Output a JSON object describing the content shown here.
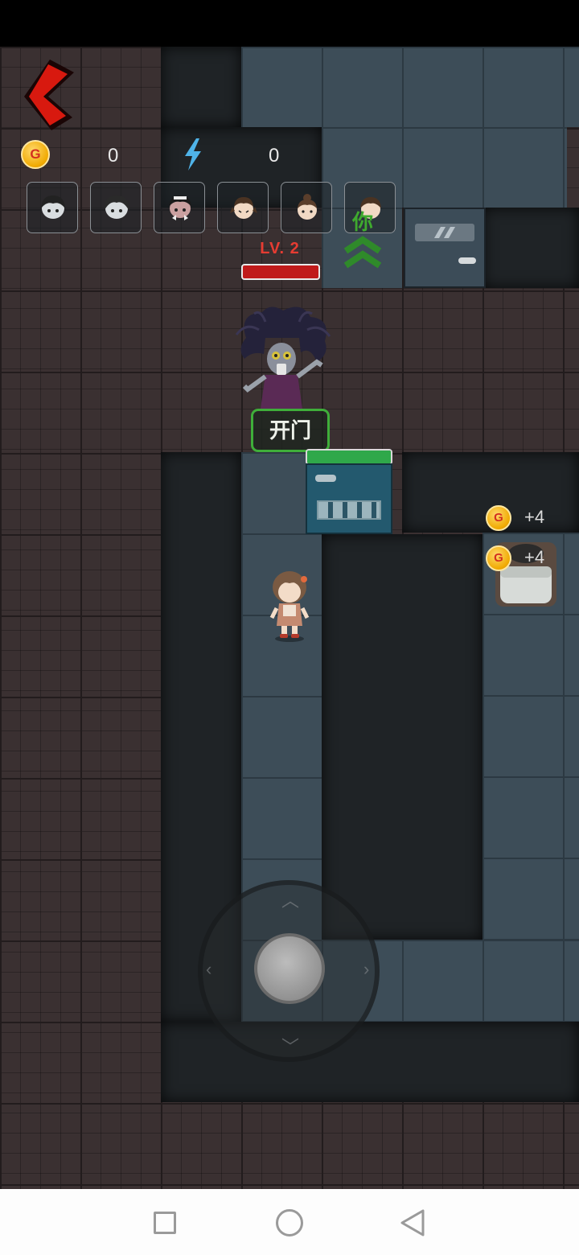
{
  "hud": {
    "coin_icon_label": "G",
    "coins": "0",
    "energy": "0",
    "icons": {
      "back": "back-chevron-icon",
      "coin": "coin-icon",
      "energy": "lightning-bolt-icon"
    },
    "avatars": [
      {
        "name": "avatar-ghost-girl-1"
      },
      {
        "name": "avatar-ghost-girl-2"
      },
      {
        "name": "avatar-maid-girl"
      },
      {
        "name": "avatar-pigtail-girl"
      },
      {
        "name": "avatar-bun-girl"
      },
      {
        "name": "avatar-player-girl"
      }
    ],
    "you_label": "你"
  },
  "ghost": {
    "level_text": "LV. 2",
    "hp": 1.0
  },
  "door": {
    "action_label": "开门",
    "hp": 1.0
  },
  "rewards": [
    {
      "label": "+4"
    },
    {
      "label": "+4"
    }
  ],
  "colors": {
    "accent_green": "#3fae3a",
    "danger_red": "#c01b1b",
    "coin_gold": "#f0a900"
  }
}
